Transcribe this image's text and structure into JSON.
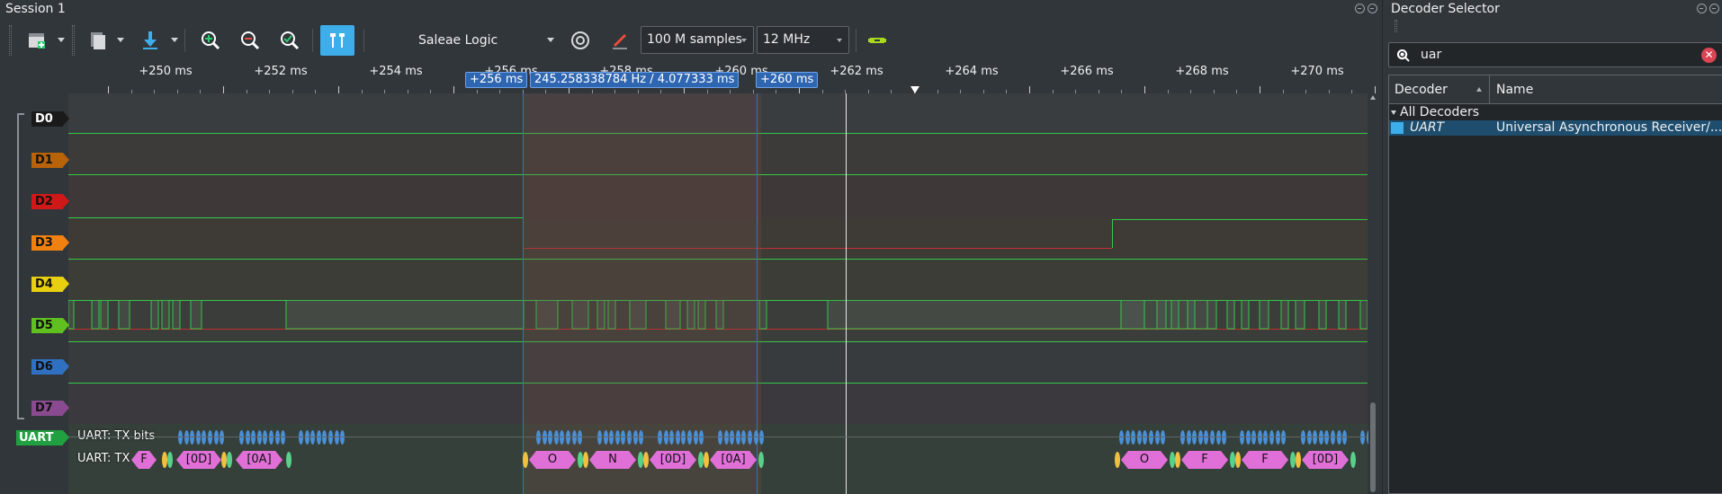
{
  "session": {
    "title": "Session 1",
    "device": "Saleae Logic",
    "samples": "100 M samples",
    "rate": "12 MHz"
  },
  "ruler": {
    "ticks": [
      "+250 ms",
      "+252 ms",
      "+254 ms",
      "+256 ms",
      "+258 ms",
      "+260 ms",
      "+262 ms",
      "+264 ms",
      "+266 ms",
      "+268 ms",
      "+270 ms"
    ],
    "marker_left": "+256 ms",
    "measurement": "245.258338784 Hz / 4.077333 ms",
    "marker_right": "+260 ms"
  },
  "channels": [
    {
      "label": "D0",
      "color": "#1a1a1a"
    },
    {
      "label": "D1",
      "color": "#b8620a"
    },
    {
      "label": "D2",
      "color": "#d01818"
    },
    {
      "label": "D3",
      "color": "#f08010"
    },
    {
      "label": "D4",
      "color": "#e8d010"
    },
    {
      "label": "D5",
      "color": "#60c020"
    },
    {
      "label": "D6",
      "color": "#3070c0"
    },
    {
      "label": "D7",
      "color": "#8a4a90"
    }
  ],
  "uart": {
    "label": "UART",
    "label_color": "#20a040",
    "bits_row": "UART: TX bits",
    "tx_row": "UART: TX",
    "frames_left": [
      "F",
      "[0D]",
      "[0A]"
    ],
    "frames_mid": [
      "O",
      "N",
      "[0D]",
      "[0A]"
    ],
    "frames_right": [
      "O",
      "F",
      "F",
      "[0D]"
    ]
  },
  "decoder_selector": {
    "title": "Decoder Selector",
    "search_value": "uar",
    "col_decoder": "Decoder",
    "col_name": "Name",
    "group": "All Decoders",
    "item_decoder": "UART",
    "item_name": "Universal Asynchronous Receiver/..."
  }
}
